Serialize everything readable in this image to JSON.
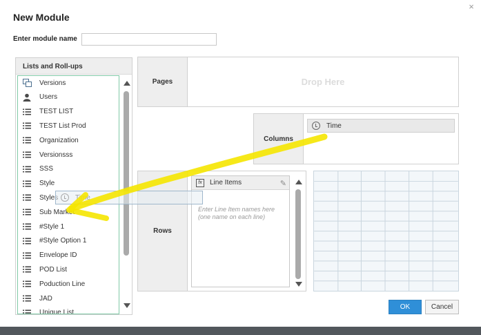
{
  "dialog": {
    "title": "New Module",
    "close_glyph": "×"
  },
  "module_name": {
    "label": "Enter module name",
    "value": ""
  },
  "lists_panel": {
    "header": "Lists and Roll-ups",
    "items": [
      {
        "label": "Versions",
        "icon": "versions-icon"
      },
      {
        "label": "Users",
        "icon": "user-icon"
      },
      {
        "label": "TEST LIST",
        "icon": "list-icon"
      },
      {
        "label": "TEST List Prod",
        "icon": "list-icon"
      },
      {
        "label": "Organization",
        "icon": "list-icon"
      },
      {
        "label": "Versionsss",
        "icon": "list-icon"
      },
      {
        "label": "SSS",
        "icon": "list-icon"
      },
      {
        "label": "Style",
        "icon": "list-icon"
      },
      {
        "label": "Styles",
        "icon": "list-icon"
      },
      {
        "label": "Sub Market",
        "icon": "list-icon"
      },
      {
        "label": "#Style 1",
        "icon": "list-icon"
      },
      {
        "label": "#Style Option 1",
        "icon": "list-icon"
      },
      {
        "label": "Envelope ID",
        "icon": "list-icon"
      },
      {
        "label": "POD List",
        "icon": "list-icon"
      },
      {
        "label": "Poduction Line",
        "icon": "list-icon"
      },
      {
        "label": "JAD",
        "icon": "list-icon"
      },
      {
        "label": "Unique List",
        "icon": "list-icon"
      }
    ]
  },
  "pages": {
    "label": "Pages",
    "drop_text": "Drop Here"
  },
  "columns": {
    "label": "Columns",
    "chip": "Time"
  },
  "rows": {
    "label": "Rows",
    "line_items_header": "Line Items",
    "placeholder": "Enter Line Item names here (one name on each line)"
  },
  "drag_ghost": {
    "label": "Time"
  },
  "buttons": {
    "ok": "OK",
    "cancel": "Cancel"
  },
  "colors": {
    "annotation_arrow": "#f5e600",
    "list_box_border": "#7fc9a6",
    "ok_button": "#2f8fd8"
  }
}
